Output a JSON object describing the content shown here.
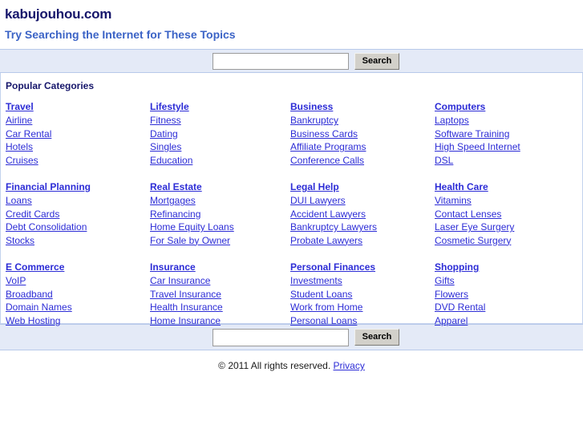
{
  "header": {
    "site_title": "kabujouhou.com",
    "tagline": "Try Searching the Internet for These Topics"
  },
  "search_top": {
    "input_value": "",
    "placeholder": "",
    "button_label": "Search"
  },
  "search_bottom": {
    "input_value": "",
    "placeholder": "",
    "button_label": "Search"
  },
  "categories": {
    "heading": "Popular Categories",
    "columns": [
      {
        "title": "Travel",
        "links": [
          "Airline",
          "Car Rental",
          "Hotels",
          "Cruises"
        ]
      },
      {
        "title": "Lifestyle",
        "links": [
          "Fitness",
          "Dating",
          "Singles",
          "Education"
        ]
      },
      {
        "title": "Business",
        "links": [
          "Bankruptcy",
          "Business Cards",
          "Affiliate Programs",
          "Conference Calls"
        ]
      },
      {
        "title": "Computers",
        "links": [
          "Laptops",
          "Software Training",
          "High Speed Internet",
          "DSL"
        ]
      },
      {
        "title": "Financial Planning",
        "links": [
          "Loans",
          "Credit Cards",
          "Debt Consolidation",
          "Stocks"
        ]
      },
      {
        "title": "Real Estate",
        "links": [
          "Mortgages",
          "Refinancing",
          "Home Equity Loans",
          "For Sale by Owner"
        ]
      },
      {
        "title": "Legal Help",
        "links": [
          "DUI Lawyers",
          "Accident Lawyers",
          "Bankruptcy Lawyers",
          "Probate Lawyers"
        ]
      },
      {
        "title": "Health Care",
        "links": [
          "Vitamins",
          "Contact Lenses",
          "Laser Eye Surgery",
          "Cosmetic Surgery"
        ]
      },
      {
        "title": "E Commerce",
        "links": [
          "VoIP",
          "Broadband",
          "Domain Names",
          "Web Hosting"
        ]
      },
      {
        "title": "Insurance",
        "links": [
          "Car Insurance",
          "Travel Insurance",
          "Health Insurance",
          "Home Insurance"
        ]
      },
      {
        "title": "Personal Finances",
        "links": [
          "Investments",
          "Student Loans",
          "Work from Home",
          "Personal Loans"
        ]
      },
      {
        "title": "Shopping",
        "links": [
          "Gifts",
          "Flowers",
          "DVD Rental",
          "Apparel"
        ]
      }
    ]
  },
  "footer": {
    "copyright": "© 2011 All rights reserved.",
    "privacy_label": "Privacy"
  },
  "colors": {
    "title": "#16166b",
    "tagline": "#3b63c6",
    "link": "#2c2cd6",
    "band_bg": "#e4eaf7",
    "band_border": "#b8c9ea",
    "box_border": "#c3d2ee",
    "button_bg": "#d2d0ca"
  }
}
